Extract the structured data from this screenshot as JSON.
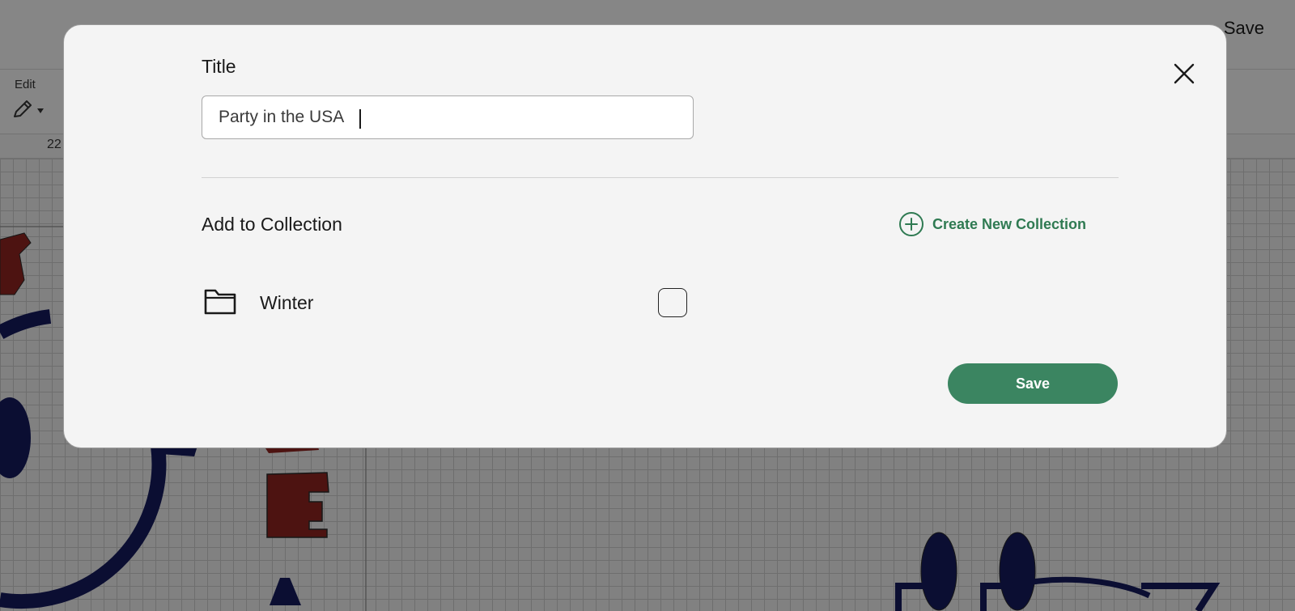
{
  "header": {
    "save_label": "Save"
  },
  "toolbar": {
    "edit_label": "Edit"
  },
  "ruler": {
    "visible_number": "22"
  },
  "dialog": {
    "title_label": "Title",
    "title_value": "Party in the USA",
    "collection_heading": "Add to Collection",
    "create_collection_label": "Create New Collection",
    "collections": [
      {
        "name": "Winter",
        "checked": false,
        "icon": "folder-icon"
      }
    ],
    "save_label": "Save",
    "close_icon": "close-icon"
  },
  "colors": {
    "accent_green": "#3b8561",
    "link_green": "#2f7a52",
    "modal_background": "#f4f4f4",
    "art_navy": "#151a5c",
    "art_red": "#8c241f"
  }
}
